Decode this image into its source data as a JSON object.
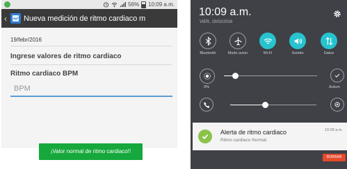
{
  "left_screen": {
    "status_bar": {
      "battery": "56%",
      "time": "10:09 a.m."
    },
    "toolbar": {
      "title": "Nueva medición de ritmo cardiaco m"
    },
    "form": {
      "date": "19/febr/2016",
      "heading": "Ingrese valores de ritmo cardiaco",
      "field_label": "Ritmo cardiaco BPM",
      "field_placeholder": "BPM",
      "field_value": ""
    },
    "button_label": "¡Valor normal de ritmo cardiaco!!"
  },
  "right_screen": {
    "time": "10:09 a.m.",
    "date": "VIER, 19/02/2016",
    "quick_settings": [
      {
        "label": "Bluetooth",
        "icon": "bluetooth-icon",
        "active": false
      },
      {
        "label": "Modo avion",
        "icon": "airplane-icon",
        "active": false
      },
      {
        "label": "Wi-Fi",
        "icon": "wifi-icon",
        "active": true
      },
      {
        "label": "Sonido",
        "icon": "sound-icon",
        "active": true
      },
      {
        "label": "Datos",
        "icon": "data-icon",
        "active": true
      }
    ],
    "brightness": {
      "percent_label": "0%",
      "level": 0.12,
      "auto_label": "Autom"
    },
    "volume": {
      "level": 0.4
    },
    "notification": {
      "title": "Alerta de ritmo cardiaco",
      "body": "Ritmo cardiaco Normal",
      "time": "10:09 a.m."
    },
    "clear_label": "BORRAR"
  },
  "colors": {
    "accent_teal": "#27c3ce",
    "button_green": "#16a83c",
    "toolbar_dark": "#3a3a3a",
    "clear_red": "#e54a2b"
  }
}
